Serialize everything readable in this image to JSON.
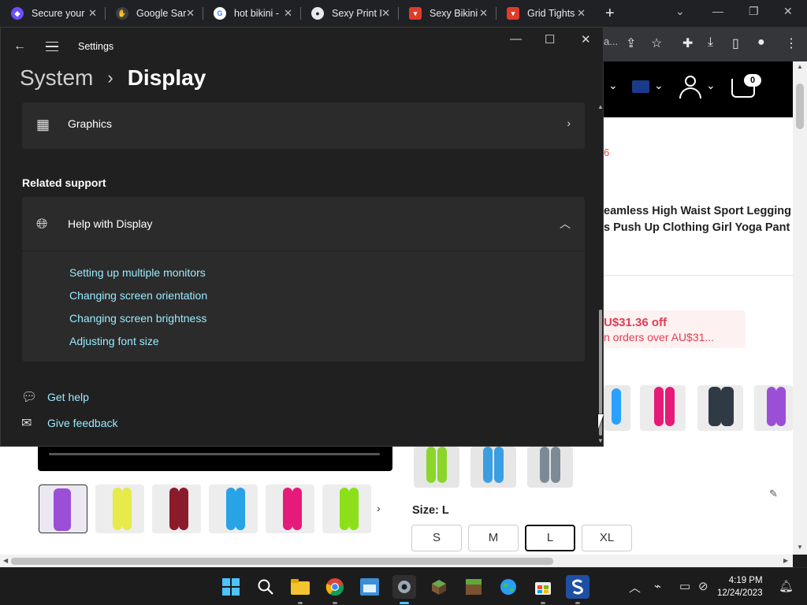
{
  "browser": {
    "tabs": [
      {
        "title": "Secure your",
        "favicon_color": "#6e4ff6",
        "favicon": "shield"
      },
      {
        "title": "Google Sar",
        "favicon_color": "#e8eaed",
        "favicon": "hand"
      },
      {
        "title": "hot bikini -",
        "favicon_color": "#ffffff",
        "favicon": "G"
      },
      {
        "title": "Sexy Print I",
        "favicon_color": "#444444",
        "favicon": "shop"
      },
      {
        "title": "Sexy Bikini",
        "favicon_color": "#e03b2b",
        "favicon": "bag"
      },
      {
        "title": "Grid Tights",
        "favicon_color": "#e03b2b",
        "favicon": "bag"
      }
    ],
    "new_tab_label": "+",
    "toolbar_fragment": "a..."
  },
  "shop": {
    "cart_count": "0",
    "red_fragment": "6",
    "title_line1": "eamless High Waist Sport Legging",
    "title_line2": "s Push Up Clothing Girl Yoga Pant",
    "coupon_line1": "U$31.36 off",
    "coupon_line2": "n orders over AU$31...",
    "size_label": "Size:",
    "size_value": "L",
    "sizes": [
      "S",
      "M",
      "L",
      "XL"
    ],
    "selected_size": "L",
    "thumb_colors_bottom": [
      "#9b4fd6",
      "#e6ea4a",
      "#8b1a2a",
      "#27a3e6",
      "#e61a78",
      "#8be01a"
    ],
    "thumb_colors_right": [
      "#2aa0ff",
      "#e61a78",
      "#2f3a45",
      "#9b4fd6"
    ],
    "thumb_colors_mid": [
      "#8bd62a",
      "#3b9ee0",
      "#7c8a95"
    ]
  },
  "settings": {
    "app_title": "Settings",
    "breadcrumb_parent": "System",
    "breadcrumb_sep": "›",
    "breadcrumb_current": "Display",
    "graphics_label": "Graphics",
    "related_support": "Related support",
    "help_title": "Help with Display",
    "help_links": [
      "Setting up multiple monitors",
      "Changing screen orientation",
      "Changing screen brightness",
      "Adjusting font size"
    ],
    "get_help": "Get help",
    "give_feedback": "Give feedback"
  },
  "taskbar": {
    "time": "4:19 PM",
    "date": "12/24/2023",
    "apps": [
      "windows-start",
      "search",
      "file-explorer",
      "chrome",
      "file-manager",
      "settings",
      "minecraft-cube",
      "minecraft-grass",
      "globe",
      "store",
      "snagit"
    ]
  }
}
